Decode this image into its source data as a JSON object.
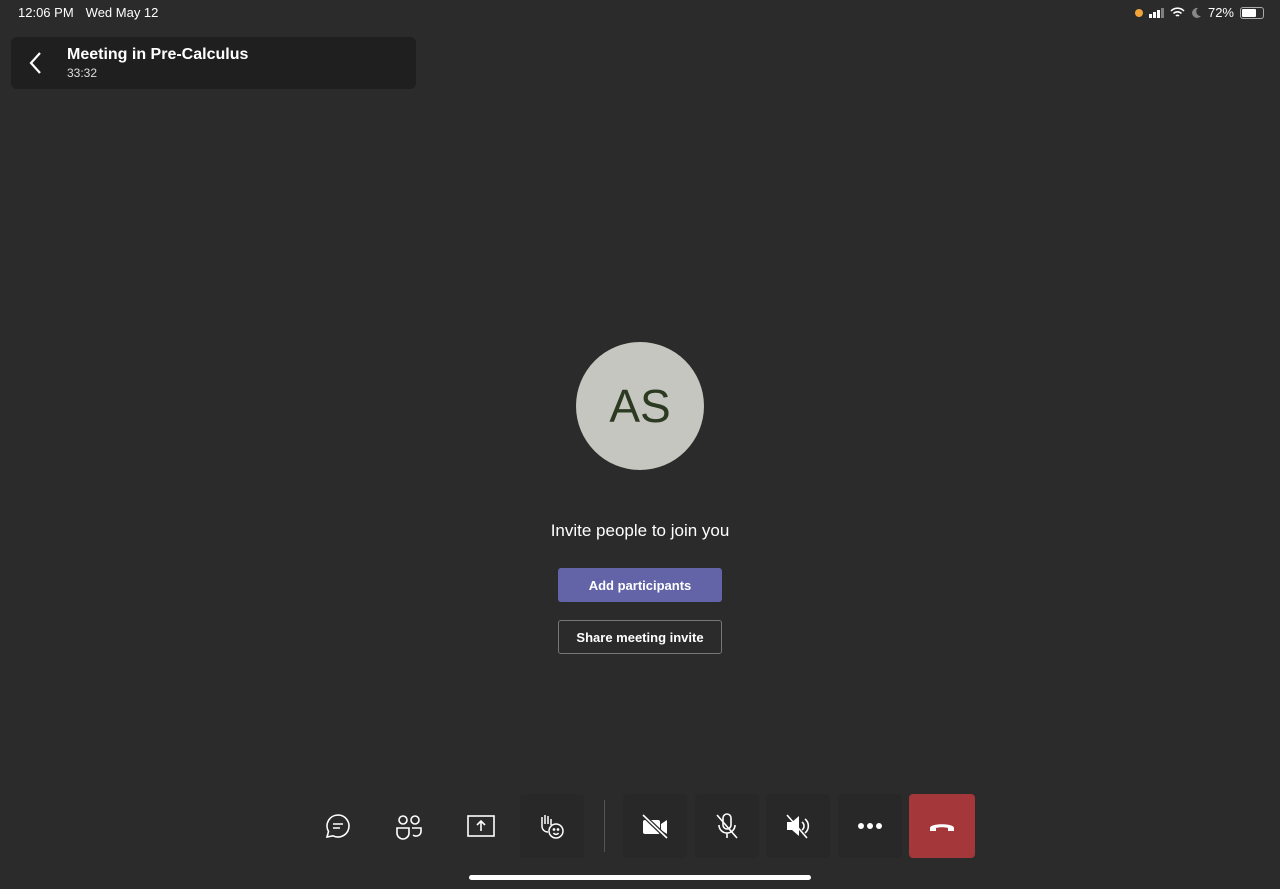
{
  "status_bar": {
    "time": "12:06 PM",
    "date": "Wed May 12",
    "battery": "72%",
    "battery_level": 0.72
  },
  "header": {
    "title": "Meeting in Pre-Calculus",
    "timer": "33:32"
  },
  "avatar": {
    "initials": "AS"
  },
  "main": {
    "invite_text": "Invite people to join you",
    "add_label": "Add participants",
    "share_label": "Share meeting invite"
  },
  "colors": {
    "accent": "#6264a7",
    "hangup": "#a4373a",
    "background": "#2b2b2b"
  }
}
